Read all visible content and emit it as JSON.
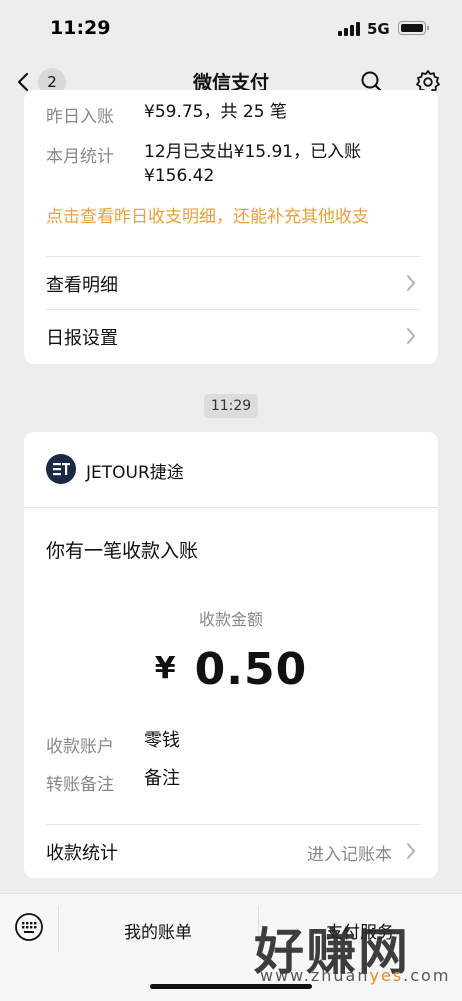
{
  "status_bar": {
    "time": "11:29",
    "network": "5G"
  },
  "nav": {
    "back_badge": "2",
    "title": "微信支付"
  },
  "daily_card": {
    "yesterday_label": "昨日入账",
    "yesterday_value": "¥59.75，共 25 笔",
    "month_label": "本月统计",
    "month_value_line1": "12月已支出¥15.91，已入账",
    "month_value_line2": "¥156.42",
    "tip": "点击查看昨日收支明细，还能补充其他收支",
    "detail_link": "查看明细",
    "settings_link": "日报设置"
  },
  "time_divider": "11:29",
  "payment_card": {
    "merchant": "JETOUR捷途",
    "title": "你有一笔收款入账",
    "amount_label": "收款金额",
    "currency": "¥",
    "amount": "0.50",
    "account_label": "收款账户",
    "account_value": "零钱",
    "remark_label": "转账备注",
    "remark_value": "备注",
    "stats_label": "收款统计",
    "stats_action": "进入记账本"
  },
  "bottom_bar": {
    "item1": "我的账单",
    "item2": "支付服务"
  },
  "watermark": {
    "text": "好赚网",
    "url_pre": "www.zhuan",
    "url_hl": "yes",
    "url_post": ".com"
  },
  "colors": {
    "tip": "#e6a23c",
    "background": "#ededed",
    "logo": "#1b2a44"
  }
}
